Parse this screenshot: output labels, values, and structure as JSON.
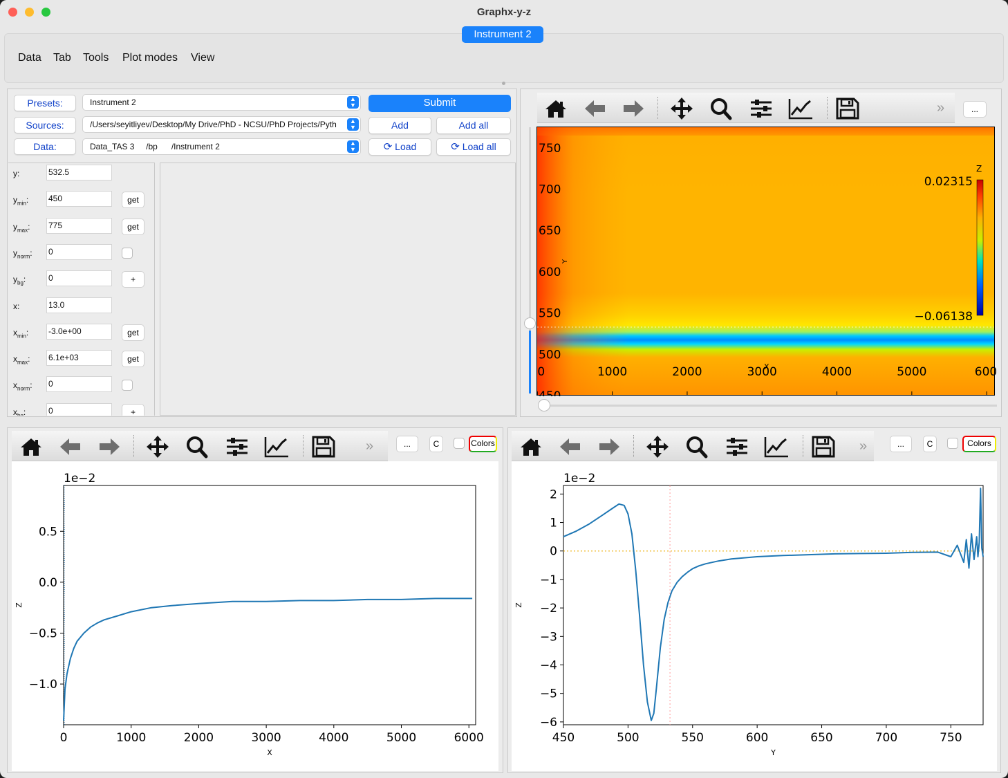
{
  "window": {
    "title": "Graphx-y-z",
    "active_tab": "Instrument 2"
  },
  "menu": [
    "Data",
    "Tab",
    "Tools",
    "Plot modes",
    "View"
  ],
  "controls": {
    "presets_label": "Presets:",
    "sources_label": "Sources:",
    "data_label": "Data:",
    "presets_value": "Instrument 2",
    "sources_value": "/Users/seyitliyev/Desktop/My Drive/PhD - NCSU/PhD Projects/Pyth",
    "data_value": "Data_TAS 3     /bp      /Instrument 2",
    "submit": "Submit",
    "add": "Add",
    "add_all": "Add all",
    "load": "Load",
    "load_all": "Load all"
  },
  "params": [
    {
      "name": "y",
      "sub": "",
      "value": "532.5",
      "action": ""
    },
    {
      "name": "y",
      "sub": "min",
      "value": "450",
      "action": "get"
    },
    {
      "name": "y",
      "sub": "max",
      "value": "775",
      "action": "get"
    },
    {
      "name": "y",
      "sub": "norm",
      "value": "0",
      "action": "check"
    },
    {
      "name": "y",
      "sub": "bg",
      "value": "0",
      "action": "+"
    },
    {
      "name": "x",
      "sub": "",
      "value": "13.0",
      "action": ""
    },
    {
      "name": "x",
      "sub": "min",
      "value": "-3.0e+00",
      "action": "get"
    },
    {
      "name": "x",
      "sub": "max",
      "value": "6.1e+03",
      "action": "get"
    },
    {
      "name": "x",
      "sub": "norm",
      "value": "0",
      "action": "check"
    },
    {
      "name": "x",
      "sub": "bg",
      "value": "0",
      "action": "+"
    }
  ],
  "toolbar": {
    "more": "...",
    "overflow": "»",
    "c_label": "C",
    "colors_label": "Colors"
  },
  "icons": [
    "home-icon",
    "back-arrow-icon",
    "forward-arrow-icon",
    "pan-icon",
    "zoom-icon",
    "configure-subplots-icon",
    "edit-axis-icon",
    "save-icon"
  ],
  "colormap": {
    "zlabel": "Z",
    "zmax": "0.02315",
    "zmin": "−0.06138",
    "ylabel": "Y",
    "xlabel": "X",
    "yticks": [
      "750",
      "700",
      "650",
      "600",
      "550",
      "500",
      "450"
    ],
    "xticks": [
      "0",
      "1000",
      "2000",
      "3000",
      "4000",
      "5000",
      "600"
    ]
  },
  "chart_data": [
    {
      "type": "line",
      "title": "",
      "offset_text": "1e−2",
      "xlabel": "X",
      "ylabel": "Z",
      "xlim": [
        0,
        6100
      ],
      "ylim": [
        -1.4,
        0.95
      ],
      "xticks": [
        "0",
        "1000",
        "2000",
        "3000",
        "4000",
        "5000",
        "6000"
      ],
      "yticks": [
        "0.5",
        "0.0",
        "−0.5",
        "−1.0"
      ],
      "series": [
        {
          "color": "#1f77b4",
          "x": [
            0,
            20,
            50,
            100,
            150,
            200,
            300,
            400,
            500,
            600,
            800,
            1000,
            1300,
            1600,
            2000,
            2500,
            3000,
            3500,
            4000,
            4500,
            5000,
            5500,
            6050
          ],
          "y": [
            -1.36,
            -1.05,
            -0.9,
            -0.75,
            -0.65,
            -0.58,
            -0.5,
            -0.44,
            -0.4,
            -0.37,
            -0.33,
            -0.29,
            -0.25,
            -0.23,
            -0.21,
            -0.19,
            -0.19,
            -0.18,
            -0.18,
            -0.17,
            -0.17,
            -0.16,
            -0.16
          ]
        }
      ]
    },
    {
      "type": "line",
      "title": "",
      "offset_text": "1e−2",
      "xlabel": "Y",
      "ylabel": "Z",
      "xlim": [
        450,
        775
      ],
      "ylim": [
        -6.1,
        2.3
      ],
      "xticks": [
        "450",
        "500",
        "550",
        "600",
        "650",
        "700",
        "750"
      ],
      "yticks": [
        "2",
        "1",
        "0",
        "−1",
        "−2",
        "−3",
        "−4",
        "−5",
        "−6"
      ],
      "markers": {
        "x_line": 532.5,
        "y_line": 0
      },
      "series": [
        {
          "color": "#1f77b4",
          "x": [
            450,
            460,
            470,
            480,
            488,
            493,
            497,
            500,
            503,
            506,
            509,
            512,
            515,
            518,
            520,
            522,
            525,
            528,
            531,
            534,
            538,
            542,
            546,
            550,
            555,
            560,
            570,
            580,
            600,
            620,
            640,
            660,
            680,
            700,
            720,
            740,
            750,
            755,
            760,
            762,
            764,
            766,
            768,
            770,
            771,
            772,
            773,
            774,
            775
          ],
          "y": [
            0.5,
            0.7,
            0.95,
            1.25,
            1.5,
            1.65,
            1.6,
            1.3,
            0.6,
            -0.7,
            -2.3,
            -4.0,
            -5.3,
            -5.95,
            -5.7,
            -4.8,
            -3.4,
            -2.4,
            -1.8,
            -1.4,
            -1.1,
            -0.9,
            -0.75,
            -0.62,
            -0.52,
            -0.45,
            -0.35,
            -0.28,
            -0.2,
            -0.16,
            -0.13,
            -0.1,
            -0.09,
            -0.08,
            -0.05,
            -0.04,
            -0.2,
            0.2,
            -0.4,
            0.4,
            -0.6,
            0.6,
            -0.3,
            0.5,
            -0.2,
            0.3,
            2.2,
            0.1,
            -0.2
          ]
        }
      ]
    }
  ]
}
